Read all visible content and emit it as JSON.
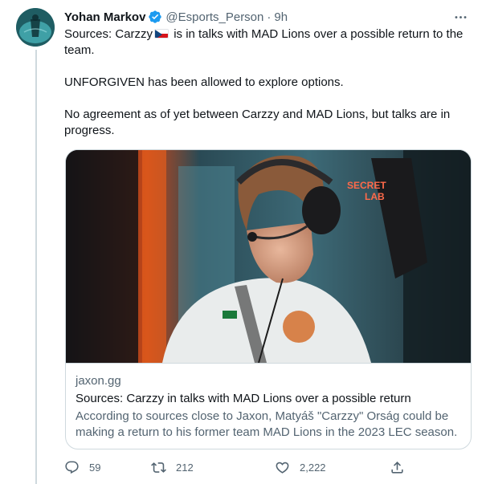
{
  "tweet": {
    "author_name": "Yohan Markov",
    "handle": "@Esports_Person",
    "separator": "·",
    "time": "9h",
    "more_icon": "more-horizontal-icon",
    "verified_icon": "verified-badge-icon",
    "paragraph1_before_flag": "Sources: Carzzy",
    "flag": "czech-flag-emoji",
    "paragraph1_after_flag": " is in talks with MAD Lions over a possible return to the team.",
    "paragraph2": "UNFORGIVEN has been allowed to explore options.",
    "paragraph3": "No agreement as of yet between Carzzy and MAD Lions, but talks are in progress."
  },
  "card": {
    "image_description": "player-photo",
    "domain": "jaxon.gg",
    "title": "Sources: Carzzy in talks with MAD Lions over a possible return",
    "description": "According to sources close to Jaxon, Matyáš \"Carzzy\" Orság could be making a return to his former team MAD Lions in the 2023 LEC season."
  },
  "actions": {
    "reply_count": "59",
    "retweet_count": "212",
    "like_count": "2,222",
    "reply_icon": "reply-icon",
    "retweet_icon": "retweet-icon",
    "like_icon": "heart-icon",
    "share_icon": "share-icon"
  },
  "colors": {
    "text_primary": "#0f1419",
    "text_secondary": "#536471",
    "verified_blue": "#1d9bf0",
    "border": "#cfd9de"
  }
}
